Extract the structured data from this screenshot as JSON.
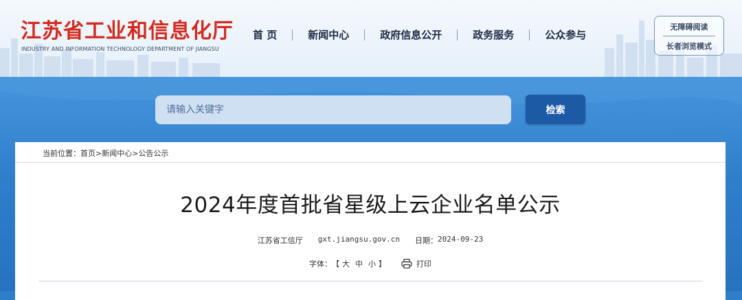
{
  "header": {
    "site_title": "江苏省工业和信息化厅",
    "site_subtitle": "INDUSTRY AND INFORMATION TECHNOLOGY DEPARTMENT OF JIANGSU",
    "nav": [
      "首 页",
      "新闻中心",
      "政府信息公开",
      "政务服务",
      "公众参与"
    ],
    "accessibility": {
      "barrier_free": "无障碍阅读",
      "elder_mode": "长者浏览模式"
    }
  },
  "search": {
    "placeholder": "请输入关键字",
    "button_label": "检索"
  },
  "breadcrumb": {
    "prefix": "当前位置：",
    "items": [
      "首页",
      "新闻中心",
      "公告公示"
    ],
    "sep": ">"
  },
  "article": {
    "title": "2024年度首批省星级上云企业名单公示",
    "source": "江苏省工信厅",
    "domain": "gxt.jiangsu.gov.cn",
    "date_label": "日期：",
    "date": "2024-09-23",
    "font_label": "字体：",
    "bracket_open": "【",
    "bracket_close": "】",
    "sizes": [
      "大",
      "中",
      "小"
    ],
    "print_label": "打印"
  },
  "colors": {
    "title_red": "#d32a1f",
    "search_button": "#1d5aa6",
    "band": "#2f7fc8"
  },
  "icons": {
    "print": "printer-icon"
  }
}
